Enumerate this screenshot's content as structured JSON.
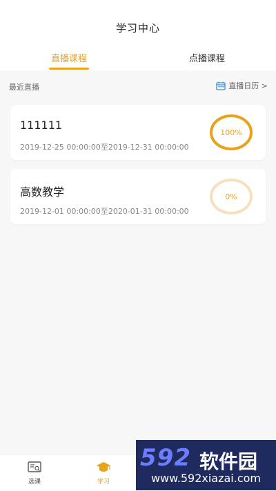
{
  "header": {
    "title": "学习中心"
  },
  "tabs": [
    {
      "label": "直播课程",
      "active": true
    },
    {
      "label": "点播课程",
      "active": false
    }
  ],
  "section": {
    "title": "最近直播",
    "calendar_link": "直播日历 >"
  },
  "courses": [
    {
      "name": "111111",
      "dates": "2019-12-25 00:00:00至2019-12-31 00:00:00",
      "progress_label": "100%",
      "progress": 1.0
    },
    {
      "name": "高数教学",
      "dates": "2019-12-01 00:00:00至2020-01-31 00:00:00",
      "progress_label": "0%",
      "progress": 0.0
    }
  ],
  "bottom_nav": [
    {
      "label": "选课",
      "icon": "course-select-icon",
      "active": false
    },
    {
      "label": "学习",
      "icon": "graduation-cap-icon",
      "active": true
    }
  ],
  "watermark": {
    "logo": "592",
    "name": "软件园",
    "url": "www.592xiazai.com"
  },
  "colors": {
    "accent": "#e8a21b",
    "ring_faint": "#f5e1bd",
    "watermark_bg": "#1f2a5e"
  }
}
